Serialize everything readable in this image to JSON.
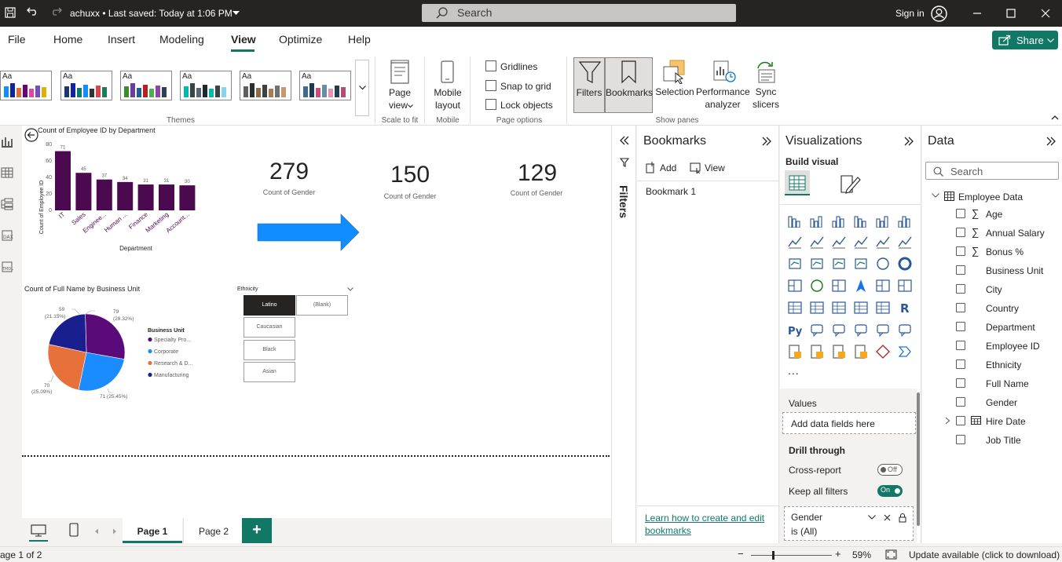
{
  "titlebar": {
    "title": "achuxx • Last saved: Today at 1:06 PM",
    "search_placeholder": "Search",
    "sign_in": "Sign in"
  },
  "menu": {
    "tabs": [
      "File",
      "Home",
      "Insert",
      "Modeling",
      "View",
      "Optimize",
      "Help"
    ],
    "active": "View",
    "share": "Share"
  },
  "ribbon": {
    "theme_aa": "Aa",
    "groups": {
      "themes": "Themes",
      "scale": "Scale to fit",
      "mobile": "Mobile",
      "page_options": "Page options",
      "show_panes": "Show panes"
    },
    "page_view": [
      "Page",
      "view"
    ],
    "mobile_layout": [
      "Mobile",
      "layout"
    ],
    "checkboxes": [
      "Gridlines",
      "Snap to grid",
      "Lock objects"
    ],
    "panes": {
      "filters": "Filters",
      "bookmarks": "Bookmarks",
      "selection": "Selection",
      "performance": [
        "Performance",
        "analyzer"
      ],
      "sync": [
        "Sync",
        "slicers"
      ]
    }
  },
  "canvas": {
    "bar_chart": {
      "title": "Count of Employee ID by Department",
      "ylabel": "Count of Employee ID",
      "xlabel": "Department",
      "yticks": [
        "80",
        "60",
        "40",
        "20",
        "0"
      ]
    },
    "cards": [
      {
        "value": "279",
        "label": "Count of Gender"
      },
      {
        "value": "150",
        "label": "Count of Gender"
      },
      {
        "value": "129",
        "label": "Count of Gender"
      }
    ],
    "pie_chart": {
      "title": "Count of Full Name by Business Unit",
      "legend_title": "Business Unit",
      "labels": [
        {
          "count": "79",
          "pct": "(28.32%)"
        },
        {
          "count": "71 (25.45%)",
          "pct": ""
        },
        {
          "count": "70",
          "pct": "(25.09%)"
        },
        {
          "count": "59",
          "pct": "(21.15%)"
        }
      ]
    },
    "slicer": {
      "title": "Ethnicity",
      "options": [
        "Latino",
        "(Blank)",
        "Caucasian",
        "Black",
        "Asian"
      ]
    }
  },
  "chart_data": {
    "type": "bar",
    "title": "Count of Employee ID by Department",
    "xlabel": "Department",
    "ylabel": "Count of Employee ID",
    "categories": [
      "IT",
      "Sales",
      "Enginee...",
      "Human ...",
      "Finance",
      "Marketing",
      "Account..."
    ],
    "values": [
      71,
      45,
      37,
      34,
      31,
      31,
      30
    ],
    "ylim": [
      0,
      80
    ],
    "bar_color": "#4b0a4f"
  },
  "pie_data": {
    "type": "pie",
    "title": "Count of Full Name by Business Unit",
    "categories": [
      "Specialty Pro...",
      "Corporate",
      "Research & D...",
      "Manufacturing"
    ],
    "values": [
      79,
      71,
      70,
      59
    ],
    "colors": [
      "#5b0a7a",
      "#1a8cff",
      "#e8703a",
      "#1a1f8f"
    ]
  },
  "filters_label": "Filters",
  "bookmarks": {
    "title": "Bookmarks",
    "add": "Add",
    "view": "View",
    "items": [
      "Bookmark 1"
    ],
    "learn": [
      "Learn how to create and edit",
      "bookmarks"
    ]
  },
  "viz": {
    "title": "Visualizations",
    "build": "Build visual",
    "more": "...",
    "values": "Values",
    "add_fields": "Add data fields here",
    "drill": "Drill through",
    "cross_report": "Cross-report",
    "cross_state": "Off",
    "keep_filters": "Keep all filters",
    "keep_state": "On",
    "filter_field": "Gender",
    "filter_value": "is (All)",
    "icon_rows": [
      [
        "stacked-bar-icon",
        "stacked-column-icon",
        "clustered-bar-icon",
        "clustered-column-icon",
        "100-bar-icon",
        "100-column-icon"
      ],
      [
        "line-chart-icon",
        "area-chart-icon",
        "stacked-area-icon",
        "ribbon-area-icon",
        "line-column-icon",
        "line-column2-icon"
      ],
      [
        "ribbon-chart-icon",
        "waterfall-icon",
        "funnel-icon",
        "scatter-icon",
        "pie-icon",
        "donut-icon"
      ],
      [
        "treemap-icon",
        "map-icon",
        "filled-map-icon",
        "azure-map-icon",
        "gauge-icon",
        "card-icon"
      ],
      [
        "multi-card-icon",
        "kpi-icon",
        "slicer-icon",
        "table-icon",
        "matrix-icon",
        "r-visual-icon"
      ],
      [
        "python-icon",
        "key-influencers-icon",
        "decomp-tree-icon",
        "qa-icon",
        "narrative-icon",
        "goals-icon"
      ],
      [
        "paginated-icon",
        "power-apps-icon",
        "power-automate-icon",
        "arcgis-icon",
        "diamond-icon",
        "chevron-visual-icon"
      ]
    ]
  },
  "data": {
    "title": "Data",
    "search": "Search",
    "table": "Employee Data",
    "fields": [
      {
        "name": "Age",
        "sigma": true
      },
      {
        "name": "Annual Salary",
        "sigma": true
      },
      {
        "name": "Bonus %",
        "sigma": true
      },
      {
        "name": "Business Unit",
        "sigma": false
      },
      {
        "name": "City",
        "sigma": false
      },
      {
        "name": "Country",
        "sigma": false
      },
      {
        "name": "Department",
        "sigma": false
      },
      {
        "name": "Employee ID",
        "sigma": false
      },
      {
        "name": "Ethnicity",
        "sigma": false
      },
      {
        "name": "Full Name",
        "sigma": false
      },
      {
        "name": "Gender",
        "sigma": false
      },
      {
        "name": "Hire Date",
        "sigma": false
      },
      {
        "name": "Job Title",
        "sigma": false
      }
    ]
  },
  "pages": {
    "tabs": [
      "Page 1",
      "Page 2"
    ],
    "add": "+"
  },
  "status": {
    "page": "age 1 of 2",
    "zoom": "59%",
    "update": "Update available (click to download)"
  }
}
